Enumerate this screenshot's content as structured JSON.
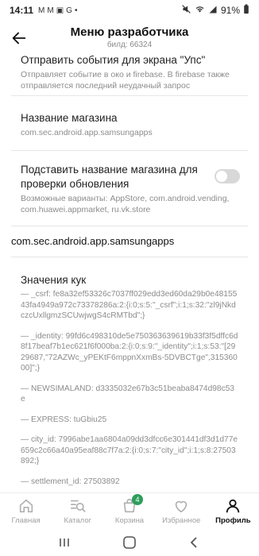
{
  "status_bar": {
    "time": "14:11",
    "left_icons": [
      "m-mail-icon",
      "m-mail-icon",
      "image-icon",
      "google-icon",
      "dot-icon"
    ],
    "battery": "91%"
  },
  "header": {
    "title": "Меню разработчика",
    "subtitle": "билд: 66324"
  },
  "sections": {
    "errors": {
      "title": "Отправить события для экрана \"Упс\"",
      "desc": "Отправляет событие в око и firebase. В firebase также отправляется последний неудачный запрос"
    },
    "store_name": {
      "title": "Название магазина",
      "value": "com.sec.android.app.samsungapps"
    },
    "store_override": {
      "title": "Подставить название магазина для проверки обновления",
      "desc": "Возможные варианты: AppStore, com.android.vending, com.huawei.appmarket, ru.vk.store",
      "enabled": false
    },
    "store_current": "com.sec.android.app.samsungapps",
    "cookies": {
      "title": "Значения кук",
      "items": [
        "— _csrf: fe8a32ef53326c7037ff029edd3ed60da29b0e4815543fa4949a972c73378286a:2:{i:0;s:5:\"_csrf\";i:1;s:32:\"zl9jNkdczcUxllgmzSCUwjwgS4cRMTbd\";}",
        "— _identity: 99fd6c498310de5e750363639619b33f3f5dffc6d8f17beaf7b1ec621f6f000ba:2:{i:0;s:9:\"_identity\";i:1;s:53:\"[2929687,\"72AZWc_yPEKtF6mppnXxmBs-5DVBCTge\",31536000]\";}",
        "— NEWSIMALAND: d3335032e67b3c51beaba8474d98c53e",
        "— EXPRESS: tuGbiu25",
        "— city_id: 7996abe1aa6804a09dd3dfcc6e301441df3d1d77e659c2c66a40a95eaf88c7f7a:2:{i:0;s:7:\"city_id\";i:1;s:8:27503892;}",
        "— settlement_id: 27503892"
      ]
    }
  },
  "bottom_nav": [
    {
      "label": "Главная",
      "icon": "home-icon",
      "active": false
    },
    {
      "label": "Каталог",
      "icon": "catalog-search-icon",
      "active": false
    },
    {
      "label": "Корзина",
      "icon": "cart-icon",
      "active": false,
      "badge": "4"
    },
    {
      "label": "Избранное",
      "icon": "heart-icon",
      "active": false
    },
    {
      "label": "Профиль",
      "icon": "profile-icon",
      "active": true
    }
  ],
  "colors": {
    "accent_green": "#2e9e5b",
    "text_primary": "#1a1a1a",
    "text_secondary": "#8c8c8c"
  }
}
